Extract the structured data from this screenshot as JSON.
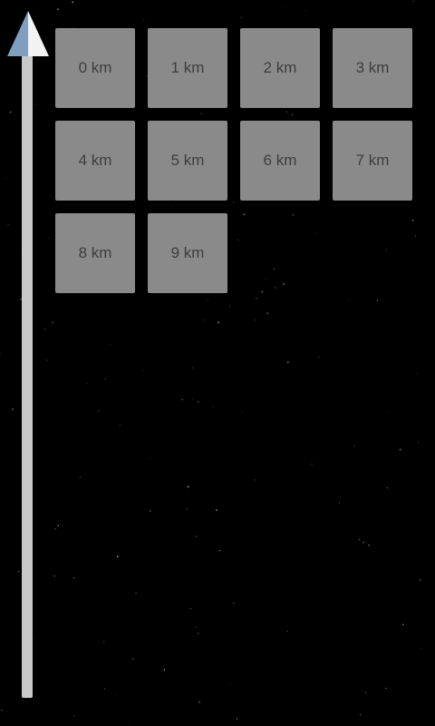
{
  "levels": [
    {
      "label": "0 km"
    },
    {
      "label": "1 km"
    },
    {
      "label": "2 km"
    },
    {
      "label": "3 km"
    },
    {
      "label": "4 km"
    },
    {
      "label": "5 km"
    },
    {
      "label": "6 km"
    },
    {
      "label": "7 km"
    },
    {
      "label": "8 km"
    },
    {
      "label": "9 km"
    }
  ],
  "colors": {
    "background": "#000000",
    "tile": "#8a8a8a",
    "tile_text": "#3d3d3d",
    "rail": "#c9c9c9",
    "arrow_left": "#7f9fbf",
    "arrow_right": "#f2f2f2"
  },
  "icons": {
    "altitude_indicator": "up-arrow-icon"
  }
}
